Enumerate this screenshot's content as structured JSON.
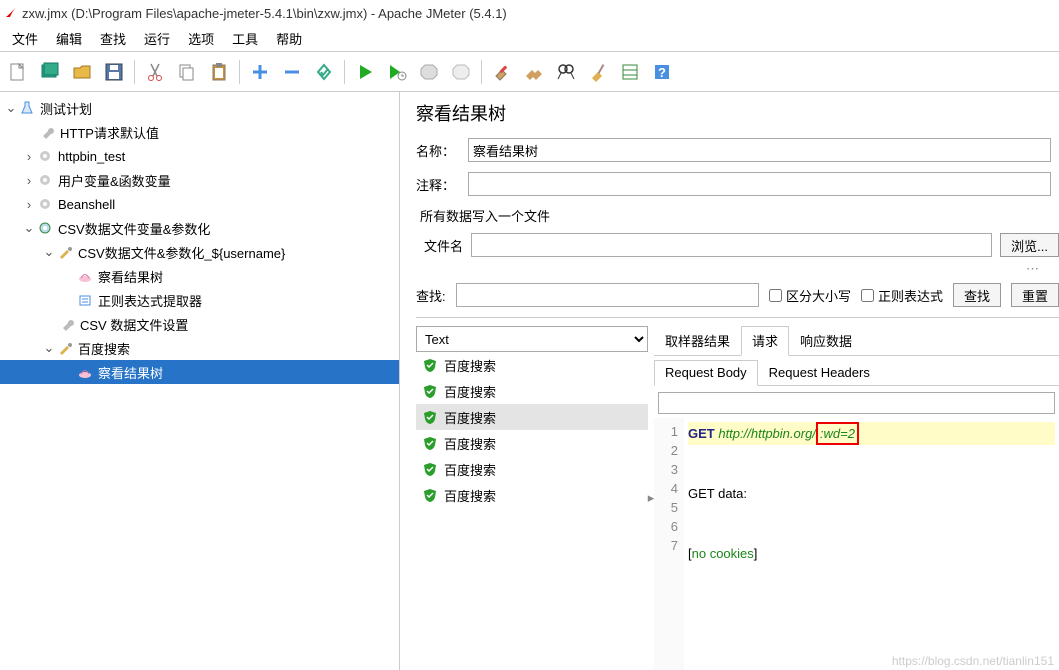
{
  "window": {
    "title": "zxw.jmx (D:\\Program Files\\apache-jmeter-5.4.1\\bin\\zxw.jmx) - Apache JMeter (5.4.1)"
  },
  "menu": {
    "file": "文件",
    "edit": "编辑",
    "search": "查找",
    "run": "运行",
    "options": "选项",
    "tools": "工具",
    "help": "帮助"
  },
  "tree": {
    "root": "测试计划",
    "http_defaults": "HTTP请求默认值",
    "httpbin": "httpbin_test",
    "vars": "用户变量&函数变量",
    "beanshell": "Beanshell",
    "csv_group": "CSV数据文件变量&参数化",
    "csv_param": "CSV数据文件&参数化_${username}",
    "view_tree_1": "察看结果树",
    "regex": "正则表达式提取器",
    "csv_set": "CSV 数据文件设置",
    "baidu": "百度搜索",
    "selected": "察看结果树"
  },
  "panel": {
    "title": "察看结果树",
    "name_label": "名称：",
    "name_value": "察看结果树",
    "comment_label": "注释：",
    "comment_value": "",
    "all_data_label": "所有数据写入一个文件",
    "filename_label": "文件名",
    "filename_value": "",
    "browse": "浏览...",
    "search_label": "查找:",
    "search_value": "",
    "case": "区分大小写",
    "regex": "正则表达式",
    "search_btn": "查找",
    "reset_btn": "重置",
    "selector": "Text"
  },
  "results": {
    "items": [
      "百度搜索",
      "百度搜索",
      "百度搜索",
      "百度搜索",
      "百度搜索",
      "百度搜索"
    ],
    "selected_index": 2
  },
  "tabs": {
    "sampler": "取样器结果",
    "request": "请求",
    "response": "响应数据"
  },
  "subtabs": {
    "body": "Request Body",
    "headers": "Request Headers"
  },
  "code": {
    "l1_a": "GET ",
    "l1_b": "http",
    "l1_c": "://httpbin.org/",
    "l1_d": ":wd=2",
    "l3": "GET data:",
    "l6a": "[",
    "l6b": "no cookies",
    "l6c": "]"
  },
  "watermark": "https://blog.csdn.net/tianlin151"
}
